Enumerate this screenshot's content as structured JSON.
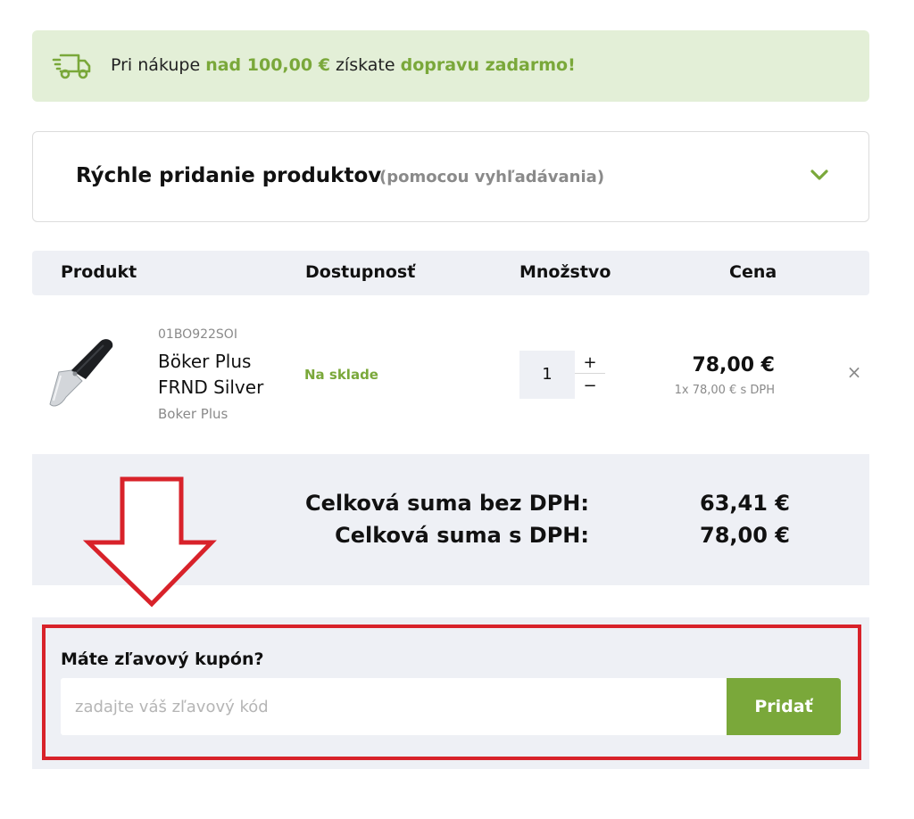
{
  "banner": {
    "icon": "delivery-truck-icon",
    "text_before": "Pri nákupe ",
    "amount": "nad 100,00 €",
    "text_middle": " získate ",
    "free_shipping": "dopravu zadarmo!"
  },
  "quick_add": {
    "title": "Rýchle pridanie produktov",
    "subtitle": "(pomocou vyhľadávania)",
    "icon": "chevron-down-icon"
  },
  "table": {
    "headers": {
      "product": "Produkt",
      "availability": "Dostupnosť",
      "quantity": "Množstvo",
      "price": "Cena"
    },
    "items": [
      {
        "sku": "01BO922SOI",
        "name": "Böker Plus FRND Silver",
        "brand": "Boker Plus",
        "availability": "Na sklade",
        "quantity": "1",
        "plus": "+",
        "minus": "−",
        "price": "78,00 €",
        "unit_price": "1x 78,00 € s DPH",
        "remove": "×"
      }
    ]
  },
  "totals": {
    "without_vat_label": "Celková suma bez DPH:",
    "without_vat_value": "63,41 €",
    "with_vat_label": "Celková suma s DPH:",
    "with_vat_value": "78,00 €"
  },
  "coupon": {
    "title": "Máte zľavový kupón?",
    "placeholder": "zadajte váš zľavový kód",
    "value": "",
    "button": "Pridať"
  },
  "colors": {
    "accent_green": "#7aa83a",
    "banner_bg": "#e3efd7",
    "panel_bg": "#eef0f5",
    "highlight_red": "#d8222a"
  }
}
